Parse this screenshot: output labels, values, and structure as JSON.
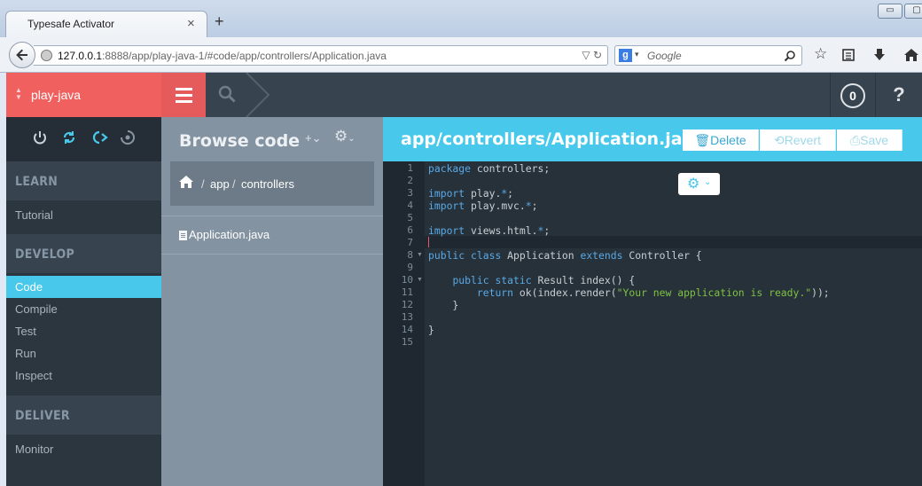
{
  "browser": {
    "tab_title": "Typesafe Activator",
    "tab_close": "×",
    "new_tab": "+",
    "url_host": "127.0.0.1",
    "url_rest": ":8888/app/play-java-1/#code/app/controllers/Application.java",
    "search_placeholder": "Google",
    "search_engine": "g",
    "win_minimize": "▭",
    "win_restore": "▢"
  },
  "header": {
    "project_name": "play-java",
    "notification_count": "0",
    "help": "?"
  },
  "sidebar": {
    "sections": [
      {
        "title": "LEARN",
        "items": [
          "Tutorial"
        ]
      },
      {
        "title": "DEVELOP",
        "items": [
          "Code",
          "Compile",
          "Test",
          "Run",
          "Inspect"
        ]
      },
      {
        "title": "DELIVER",
        "items": [
          "Monitor"
        ]
      }
    ],
    "active_item": "Code"
  },
  "browse": {
    "title": "Browse code",
    "add": "+⌄",
    "breadcrumb": [
      "app",
      "controllers"
    ],
    "files": [
      "Application.java"
    ]
  },
  "editor": {
    "file_path": "app/controllers/Application.java",
    "delete_label": "Delete",
    "revert_label": "Revert",
    "save_label": "Save",
    "line_numbers": [
      "1",
      "2",
      "3",
      "4",
      "5",
      "6",
      "7",
      "8",
      "9",
      "10",
      "11",
      "12",
      "13",
      "14",
      "15"
    ],
    "lines": [
      "package controllers;",
      "",
      "import play.*;",
      "import play.mvc.*;",
      "",
      "import views.html.*;",
      "",
      "public class Application extends Controller {",
      "",
      "    public static Result index() {",
      "        return ok(index.render(\"Your new application is ready.\"));",
      "    }",
      "",
      "}",
      ""
    ]
  },
  "colors": {
    "accent_red": "#f0605e",
    "accent_blue": "#48c9ec",
    "sidebar_dark": "#2c363f"
  }
}
